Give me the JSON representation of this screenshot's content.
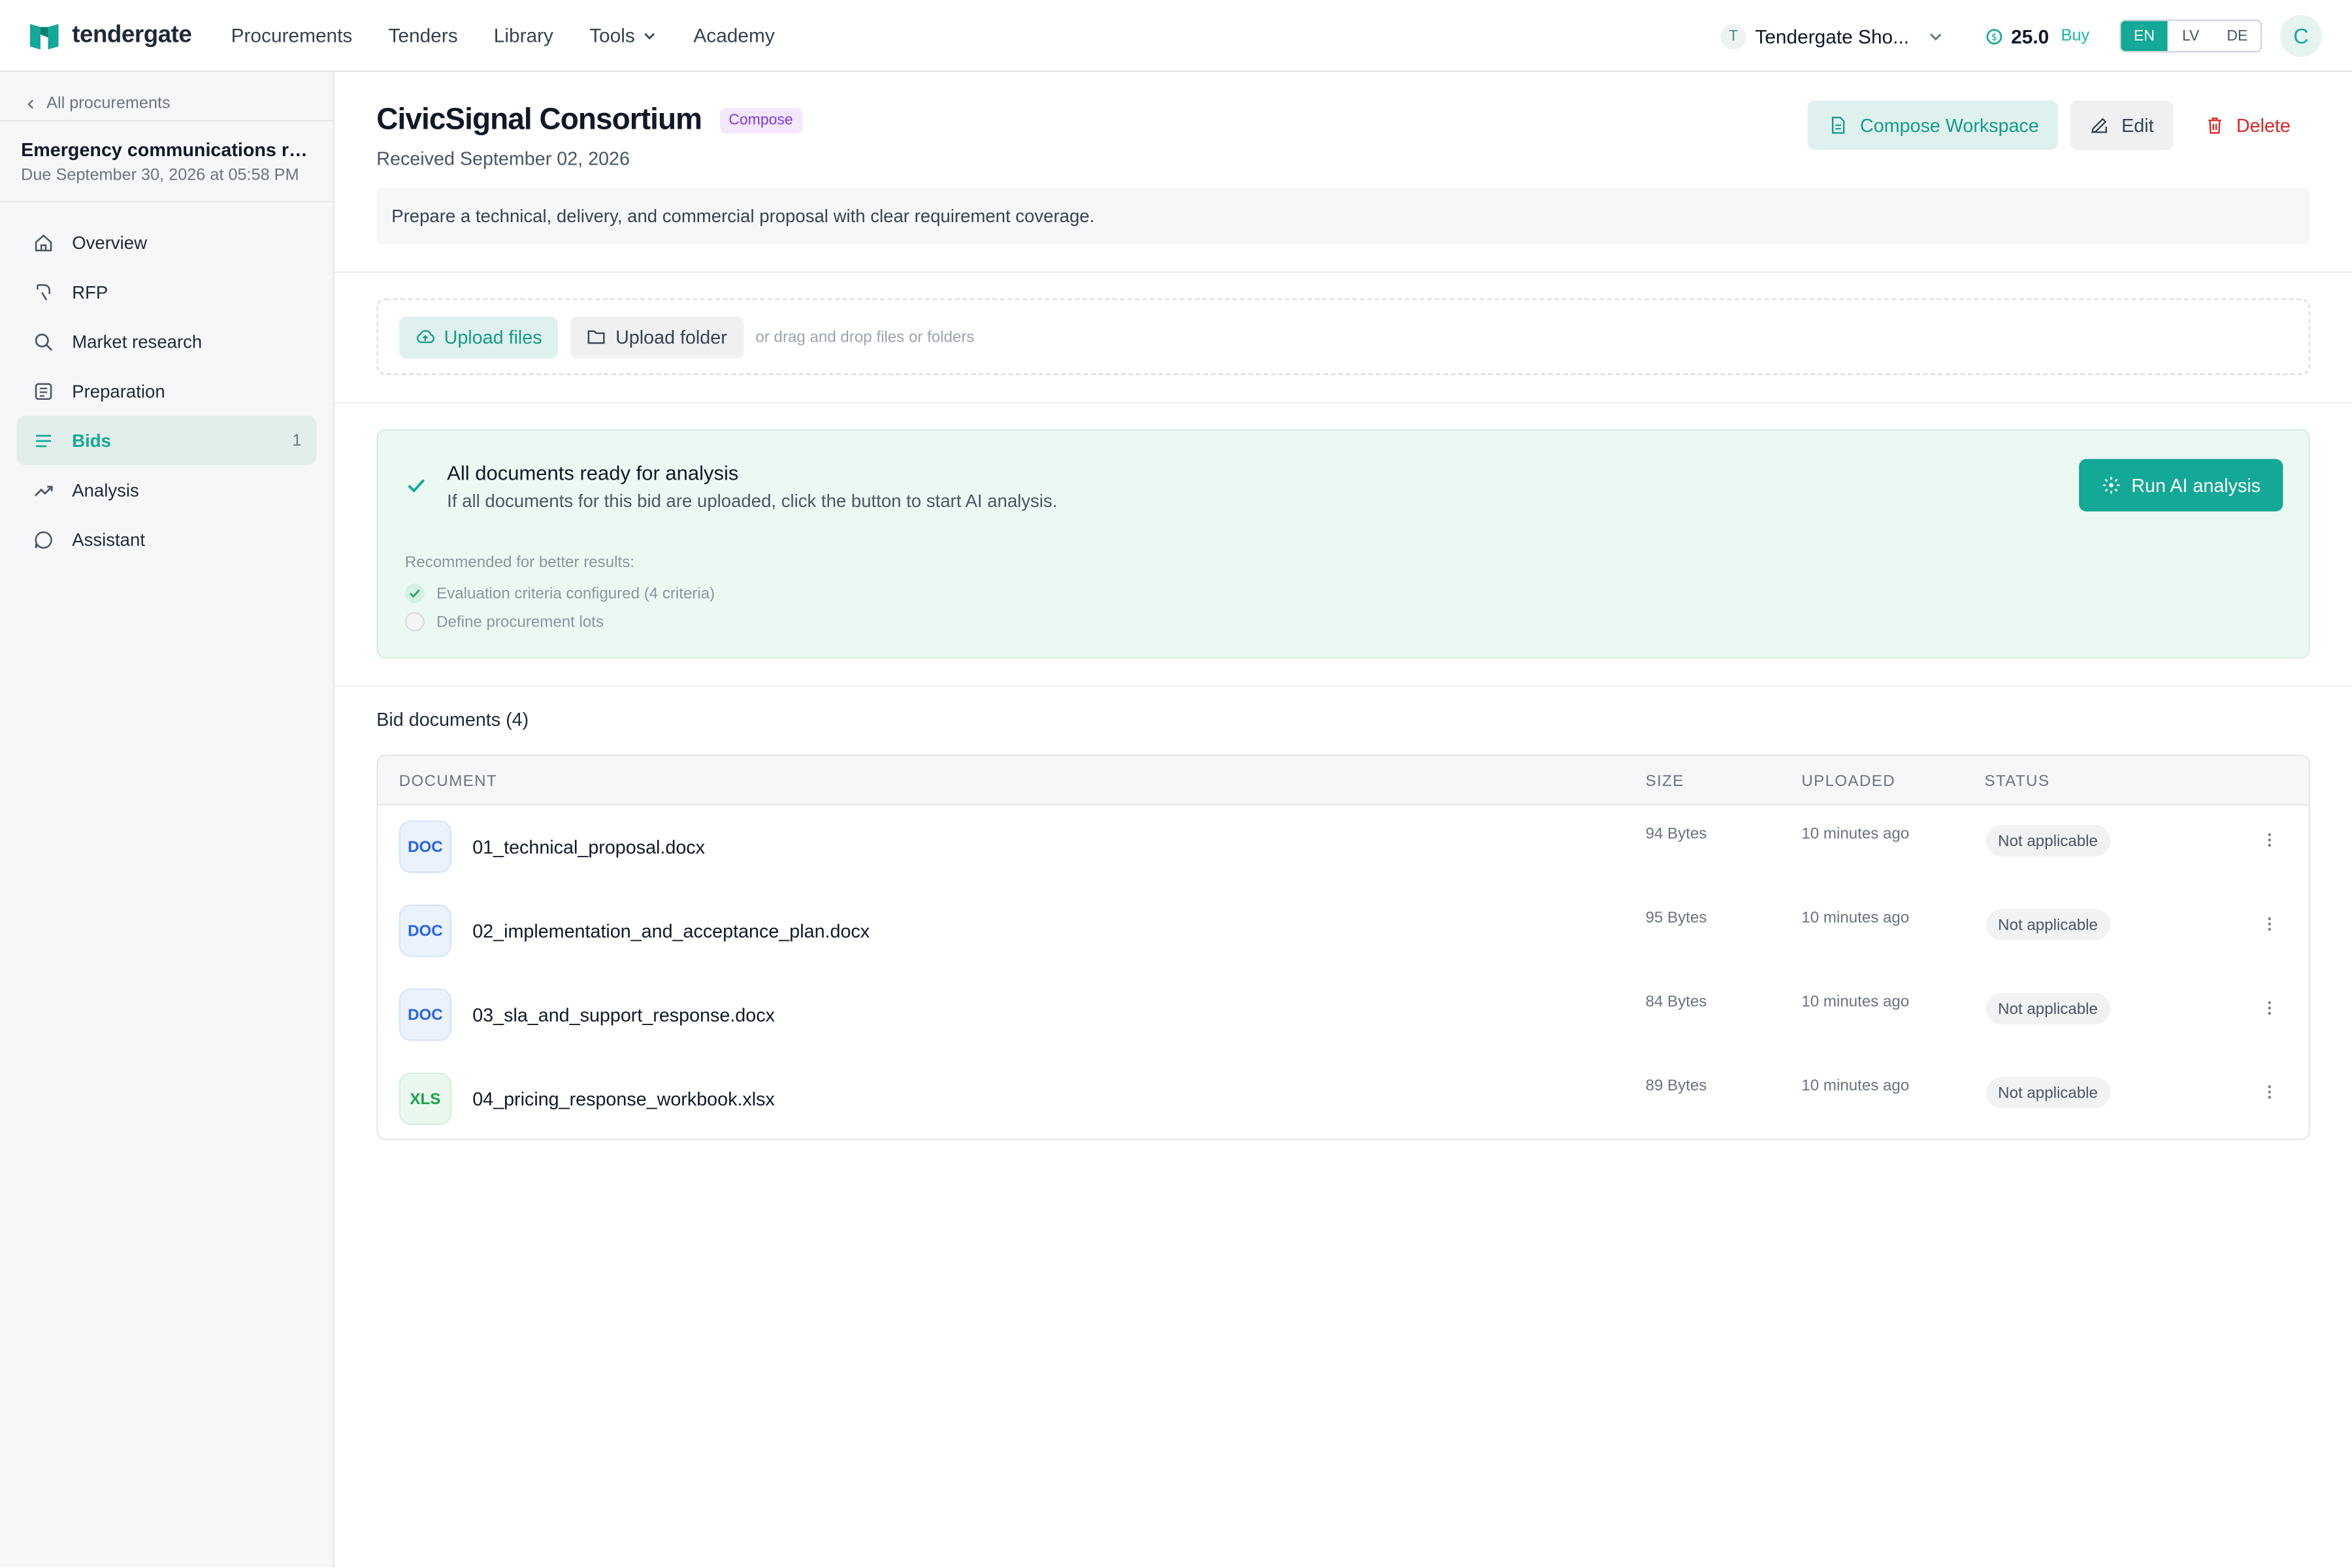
{
  "app": {
    "name": "tendergate",
    "nav": [
      "Procurements",
      "Tenders",
      "Library",
      "Tools",
      "Academy"
    ],
    "org_initial": "T",
    "org_name": "Tendergate Sho...",
    "credits": "25.0",
    "buy_label": "Buy",
    "languages": [
      "EN",
      "LV",
      "DE"
    ],
    "active_language": "EN",
    "avatar_initial": "C",
    "accent_color": "#14a896"
  },
  "sidebar": {
    "back_label": "All procurements",
    "procurement_title": "Emergency communications re...",
    "procurement_due": "Due September 30, 2026 at 05:58 PM",
    "items": [
      {
        "label": "Overview",
        "icon": "home-icon"
      },
      {
        "label": "RFP",
        "icon": "rfp-icon"
      },
      {
        "label": "Market research",
        "icon": "search-icon"
      },
      {
        "label": "Preparation",
        "icon": "preparation-icon"
      },
      {
        "label": "Bids",
        "icon": "list-icon",
        "count": "1",
        "active": true
      },
      {
        "label": "Analysis",
        "icon": "trend-icon"
      },
      {
        "label": "Assistant",
        "icon": "chat-icon"
      }
    ]
  },
  "bid": {
    "title": "CivicSignal Consortium",
    "badge": "Compose",
    "received": "Received September 02, 2026",
    "description": "Prepare a technical, delivery, and commercial proposal with clear requirement coverage.",
    "actions": {
      "compose": "Compose Workspace",
      "edit": "Edit",
      "delete": "Delete"
    }
  },
  "upload": {
    "files_label": "Upload files",
    "folder_label": "Upload folder",
    "hint": "or drag and drop files or folders"
  },
  "ready": {
    "title": "All documents ready for analysis",
    "subtitle": "If all documents for this bid are uploaded, click the button to start AI analysis.",
    "run_label": "Run AI analysis",
    "recommended_label": "Recommended for better results:",
    "recommendations": [
      {
        "label": "Evaluation criteria configured (4 criteria)",
        "done": true
      },
      {
        "label": "Define procurement lots",
        "done": false
      }
    ]
  },
  "documents": {
    "title": "Bid documents (4)",
    "columns": [
      "DOCUMENT",
      "SIZE",
      "UPLOADED",
      "STATUS"
    ],
    "rows": [
      {
        "type": "DOC",
        "name": "01_technical_proposal.docx",
        "size": "94 Bytes",
        "uploaded": "10 minutes ago",
        "status": "Not applicable"
      },
      {
        "type": "DOC",
        "name": "02_implementation_and_acceptance_plan.docx",
        "size": "95 Bytes",
        "uploaded": "10 minutes ago",
        "status": "Not applicable"
      },
      {
        "type": "DOC",
        "name": "03_sla_and_support_response.docx",
        "size": "84 Bytes",
        "uploaded": "10 minutes ago",
        "status": "Not applicable"
      },
      {
        "type": "XLS",
        "name": "04_pricing_response_workbook.xlsx",
        "size": "89 Bytes",
        "uploaded": "10 minutes ago",
        "status": "Not applicable"
      }
    ]
  }
}
